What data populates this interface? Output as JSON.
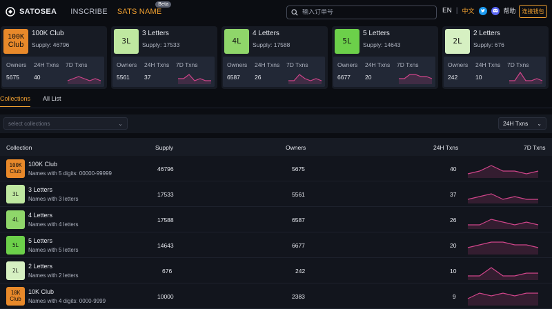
{
  "header": {
    "logo": "SATOSEA",
    "nav": [
      {
        "label": "INSCRIBE"
      },
      {
        "label": "SATS NAME",
        "badge": "Beta"
      }
    ],
    "search_placeholder": "输入订单号",
    "lang_en": "EN",
    "lang_cn": "中文",
    "help": "帮助",
    "connect": "连接钱包"
  },
  "colors": {
    "accent": "#f0a030",
    "orange_badge": "#e8892a",
    "green_light": "#bfe8a0",
    "green_mid": "#8fd66a",
    "green_bright": "#6cd04a",
    "green_pale": "#d6f0c2",
    "sparkline": "#d0458a"
  },
  "cards": [
    {
      "badge": "100K\nClub",
      "badge_l1": "100K",
      "badge_l2": "Club",
      "title": "100K Club",
      "supply": "Supply: 46796",
      "owners_label": "Owners",
      "txns24_label": "24H Txns",
      "txns7_label": "7D Txns",
      "owners": "5675",
      "txns24": "40",
      "spark": [
        5,
        4,
        3,
        4,
        5,
        4,
        5
      ]
    },
    {
      "badge_l1": "3L",
      "badge_l2": "",
      "title": "3 Letters",
      "supply": "Supply: 17533",
      "owners_label": "Owners",
      "txns24_label": "24H Txns",
      "txns7_label": "7D Txns",
      "owners": "5561",
      "txns24": "37",
      "spark": [
        4,
        4,
        2,
        5,
        4,
        5,
        5
      ]
    },
    {
      "badge_l1": "4L",
      "badge_l2": "",
      "title": "4 Letters",
      "supply": "Supply: 17588",
      "owners_label": "Owners",
      "txns24_label": "24H Txns",
      "txns7_label": "7D Txns",
      "owners": "6587",
      "txns24": "26",
      "spark": [
        5,
        5,
        2,
        4,
        5,
        4,
        5
      ]
    },
    {
      "badge_l1": "5L",
      "badge_l2": "",
      "title": "5 Letters",
      "supply": "Supply: 14643",
      "owners_label": "Owners",
      "txns24_label": "24H Txns",
      "txns7_label": "7D Txns",
      "owners": "6677",
      "txns24": "20",
      "spark": [
        4,
        4,
        2,
        2,
        3,
        3,
        4
      ]
    },
    {
      "badge_l1": "2L",
      "badge_l2": "",
      "title": "2 Letters",
      "supply": "Supply: 676",
      "owners_label": "Owners",
      "txns24_label": "24H Txns",
      "txns7_label": "7D Txns",
      "owners": "242",
      "txns24": "10",
      "spark": [
        5,
        5,
        1,
        5,
        5,
        4,
        5
      ]
    }
  ],
  "tabs": [
    {
      "label": "Collections"
    },
    {
      "label": "All List"
    }
  ],
  "filter": {
    "select_placeholder": "select collections",
    "period": "24H Txns"
  },
  "table": {
    "headers": {
      "collection": "Collection",
      "supply": "Supply",
      "owners": "Owners",
      "txns24": "24H Txns",
      "txns7": "7D Txns"
    },
    "rows": [
      {
        "badge_l1": "100K",
        "badge_l2": "Club",
        "name": "100K Club",
        "desc": "Names with 5 digits: 00000-99999",
        "supply": "46796",
        "owners": "5675",
        "txns24": "40",
        "spark": [
          5,
          4,
          2,
          4,
          4,
          5,
          4
        ]
      },
      {
        "badge_l1": "3L",
        "badge_l2": "",
        "name": "3 Letters",
        "desc": "Names with 3 letters",
        "supply": "17533",
        "owners": "5561",
        "txns24": "37",
        "spark": [
          5,
          4,
          3,
          5,
          4,
          5,
          5
        ]
      },
      {
        "badge_l1": "4L",
        "badge_l2": "",
        "name": "4 Letters",
        "desc": "Names with 4 letters",
        "supply": "17588",
        "owners": "6587",
        "txns24": "26",
        "spark": [
          5,
          5,
          3,
          4,
          5,
          4,
          5
        ]
      },
      {
        "badge_l1": "5L",
        "badge_l2": "",
        "name": "5 Letters",
        "desc": "Names with 5 letters",
        "supply": "14643",
        "owners": "6677",
        "txns24": "20",
        "spark": [
          4,
          3,
          2,
          2,
          3,
          3,
          4
        ]
      },
      {
        "badge_l1": "2L",
        "badge_l2": "",
        "name": "2 Letters",
        "desc": "Names with 2 letters",
        "supply": "676",
        "owners": "242",
        "txns24": "10",
        "spark": [
          5,
          5,
          2,
          5,
          5,
          4,
          4
        ]
      },
      {
        "badge_l1": "10K",
        "badge_l2": "Club",
        "name": "10K Club",
        "desc": "Names with 4 digits: 0000-9999",
        "supply": "10000",
        "owners": "2383",
        "txns24": "9",
        "spark": [
          4,
          2,
          3,
          2,
          3,
          2,
          2
        ]
      }
    ]
  }
}
